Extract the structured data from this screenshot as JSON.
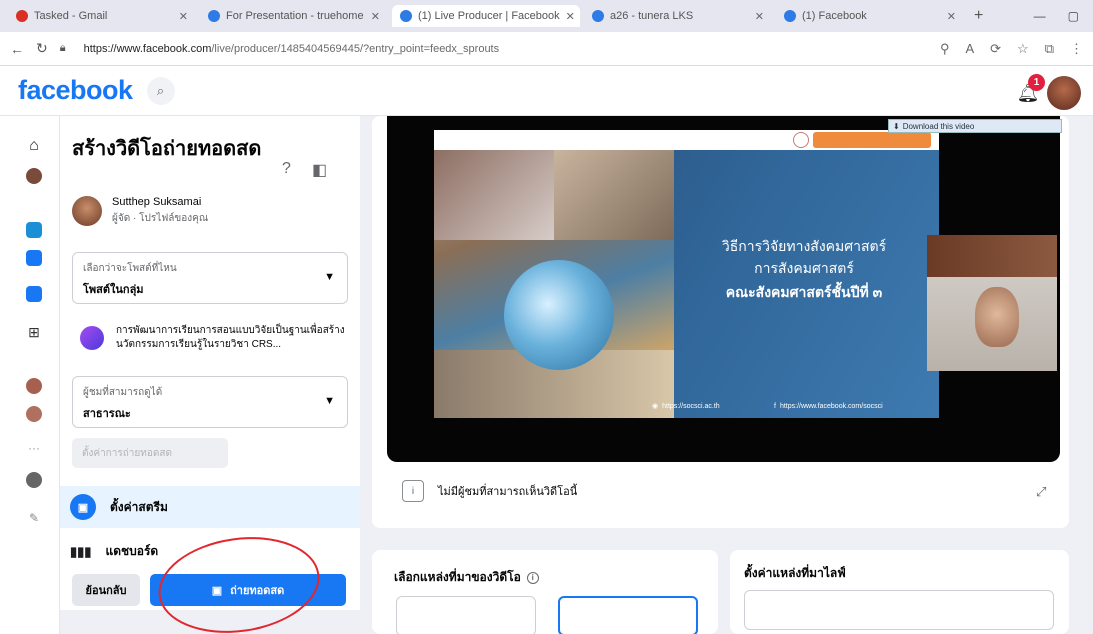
{
  "browser": {
    "tabs": [
      {
        "label": "Tasked - Gmail",
        "active": false
      },
      {
        "label": "For Presentation - truehome",
        "active": false
      },
      {
        "label": "(1) Live Producer | Facebook",
        "active": true
      },
      {
        "label": "a26 - tunera LKS",
        "active": false
      },
      {
        "label": "(1) Facebook",
        "active": false
      }
    ],
    "new_tab": "+",
    "url_host": "https://www.facebook.com",
    "url_path": "/live/producer/1485404569445/?entry_point=feedx_sprouts"
  },
  "facebook": {
    "logo": "facebook",
    "notification_count": "1"
  },
  "panel": {
    "title": "สร้างวิดีโอถ่ายทอดสด",
    "user_name": "Sutthep Suksamai",
    "user_sub": "ผู้จัด · โปรไฟล์ของคุณ",
    "post_label": "เลือกว่าจะโพสต์ที่ไหน",
    "post_value": "โพสต์ในกลุ่ม",
    "event_text": "การพัฒนาการเรียนการสอนแบบวิจัยเป็นฐานเพื่อสร้างนวัตกรรมการเรียนรู้ในรายวิชา CRS...",
    "audience_label": "ผู้ชมที่สามารถดูได้",
    "audience_value": "สาธารณะ",
    "disabled_btn": "ตั้งค่าการถ่ายทอดสด",
    "menu_settings": "ตั้งค่าสตรีม",
    "menu_dashboard": "แดชบอร์ด",
    "back_btn": "ย้อนกลับ",
    "golive_btn": "ถ่ายทอดสด"
  },
  "video": {
    "slide_line1": "วิธีการวิจัยทางสังคมศาสตร์",
    "slide_line2": "การสังคมศาสตร์",
    "slide_line3": "คณะสังคมศาสตร์ชั้นปีที่ ๓",
    "footer_left": "https://socsci.ac.th",
    "footer_right": "https://www.facebook.com/socsci",
    "download_bar": "Download this video",
    "caption": "ไม่มีผู้ชมที่สามารถเห็นวิดีโอนี้"
  },
  "bottom": {
    "card2_title": "เลือกแหล่งที่มาของวิดีโอ",
    "card3_title": "ตั้งค่าแหล่งที่มาไลฟ์"
  },
  "colors": {
    "brand": "#1877f2",
    "annotation_circle": "#e3262e",
    "badge": "#e41e3f"
  }
}
